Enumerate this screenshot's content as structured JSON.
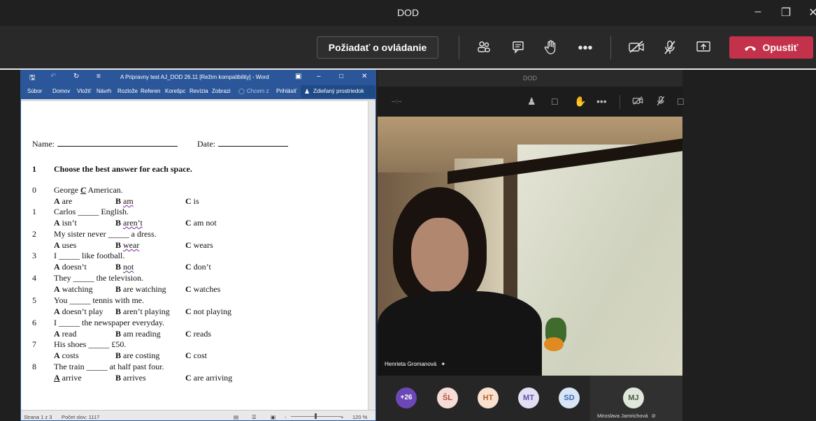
{
  "window": {
    "title": "DOD"
  },
  "callbar": {
    "request_control": "Požiadať o ovládanie",
    "leave": "Opustiť",
    "leave_icon": "phone-hangup-icon"
  },
  "word": {
    "title": "A Pripravny test AJ_DOD 26.11 [Režim kompatibility] - Word",
    "ribbon": [
      "Súbor",
      "Domov",
      "Vložiť",
      "Návrh",
      "Rozlože",
      "Referen",
      "Korešpc",
      "Revízia",
      "Zobrazi",
      "Chcem z",
      "Prihlásiť",
      "Zdieľaný prostriedok"
    ],
    "status": {
      "page": "Strana 1 z 3",
      "words": "Počet slov: 1117",
      "zoom": "120 %"
    }
  },
  "doc": {
    "name_label": "Name:",
    "date_label": "Date:",
    "section_num": "1",
    "section_title": "Choose the best answer for each space.",
    "questions": [
      {
        "num": "0",
        "pre": "George ",
        "ans": "C",
        "post": " American.",
        "a": "are",
        "b": "am",
        "c": "is"
      },
      {
        "num": "1",
        "stem": "Carlos _____ English.",
        "a": "isn’t",
        "b": "aren’t",
        "c": "am not"
      },
      {
        "num": "2",
        "stem": "My sister never _____ a dress.",
        "a": "uses",
        "b": "wear",
        "c": "wears"
      },
      {
        "num": "3",
        "stem": "I _____ like football.",
        "a": "doesn’t",
        "b": "not",
        "c": "don’t"
      },
      {
        "num": "4",
        "stem": "They _____ the television.",
        "a": "watching",
        "b": "are watching",
        "c": "watches"
      },
      {
        "num": "5",
        "stem": "You _____ tennis with me.",
        "a": "doesn’t play",
        "b": "aren’t playing",
        "c": "not playing"
      },
      {
        "num": "6",
        "stem": "I _____ the newspaper everyday.",
        "a": "read",
        "b": "am reading",
        "c": "reads"
      },
      {
        "num": "7",
        "stem": "His shoes _____ £50.",
        "a": "costs",
        "b": "are costing",
        "c": "cost"
      },
      {
        "num": "8",
        "stem": "The train _____ at half past four.",
        "a": "arrive",
        "b": "arrives",
        "c": "are arriving"
      }
    ],
    "letters": {
      "a": "A",
      "b": "B",
      "c": "C"
    }
  },
  "video": {
    "panel_title": "DOD",
    "timer": "--:--",
    "participant": "Henrieta Gromanová",
    "more_count": "+26",
    "avatars": [
      {
        "initials": "ŠL",
        "bg": "#f6dcd6",
        "fg": "#b2503f"
      },
      {
        "initials": "HT",
        "bg": "#f9e0cf",
        "fg": "#b0622f"
      },
      {
        "initials": "MT",
        "bg": "#e2dff4",
        "fg": "#5b54a2"
      },
      {
        "initials": "SD",
        "bg": "#d7e5f6",
        "fg": "#3f6aa6"
      }
    ],
    "self": {
      "initials": "MJ",
      "name": "Miroslava Jamrichová"
    }
  },
  "colors": {
    "teams_bg": "#292929",
    "leave_red": "#c4314b",
    "word_blue": "#2b579a",
    "more_badge": "#6b47b8"
  }
}
